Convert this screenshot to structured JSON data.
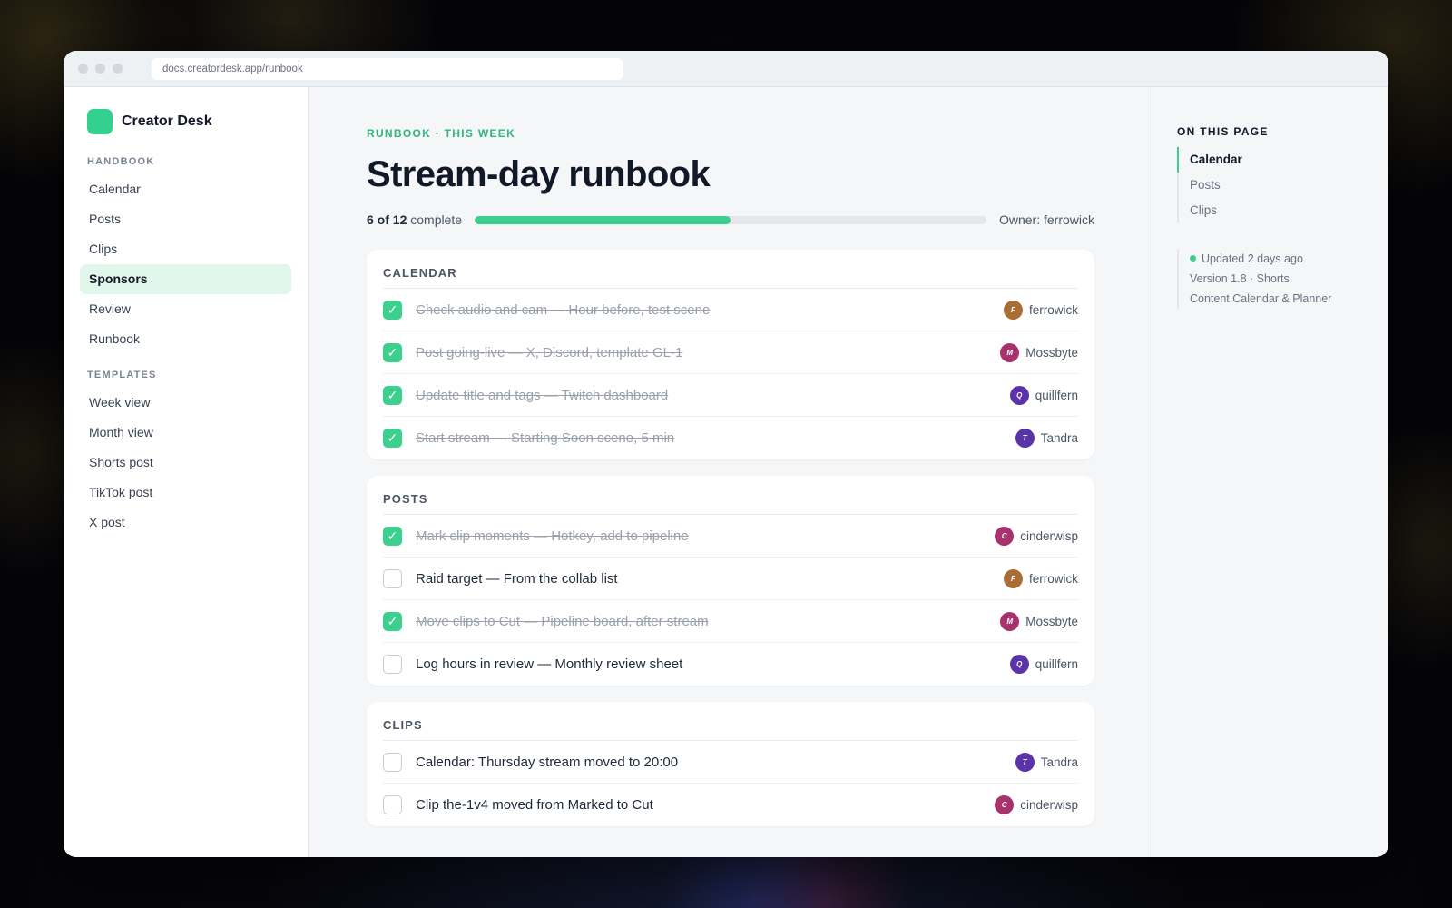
{
  "browser": {
    "url": "docs.creatordesk.app/runbook"
  },
  "sidebar": {
    "brand": "Creator Desk",
    "sections": [
      {
        "heading": "HANDBOOK",
        "items": [
          "Calendar",
          "Posts",
          "Clips",
          "Sponsors",
          "Review",
          "Runbook"
        ]
      },
      {
        "heading": "TEMPLATES",
        "items": [
          "Week view",
          "Month view",
          "Shorts post",
          "TikTok post",
          "X post"
        ]
      }
    ],
    "active_item": "Sponsors"
  },
  "page": {
    "eyebrow": "RUNBOOK · THIS WEEK",
    "title": "Stream-day runbook",
    "progress": {
      "done_label": "6 of 12",
      "suffix": "complete",
      "fraction": 0.5
    },
    "owner": "Owner: ferrowick"
  },
  "people": {
    "ferrowick": {
      "initial": "F",
      "color": "#a86e35"
    },
    "Mossbyte": {
      "initial": "M",
      "color": "#a8326c"
    },
    "quillfern": {
      "initial": "Q",
      "color": "#5b33a8"
    },
    "Tandra": {
      "initial": "T",
      "color": "#5b33a8"
    },
    "cinderwisp": {
      "initial": "C",
      "color": "#a8326c"
    }
  },
  "sections": [
    {
      "title": "CALENDAR",
      "tasks": [
        {
          "text": "Check audio and cam — Hour before, test scene",
          "done": true,
          "assignee": "ferrowick"
        },
        {
          "text": "Post going-live — X, Discord, template GL-1",
          "done": true,
          "assignee": "Mossbyte"
        },
        {
          "text": "Update title and tags — Twitch dashboard",
          "done": true,
          "assignee": "quillfern"
        },
        {
          "text": "Start stream — Starting Soon scene, 5 min",
          "done": true,
          "assignee": "Tandra"
        }
      ]
    },
    {
      "title": "POSTS",
      "tasks": [
        {
          "text": "Mark clip moments — Hotkey, add to pipeline",
          "done": true,
          "assignee": "cinderwisp"
        },
        {
          "text": "Raid target — From the collab list",
          "done": false,
          "assignee": "ferrowick"
        },
        {
          "text": "Move clips to Cut — Pipeline board, after stream",
          "done": true,
          "assignee": "Mossbyte"
        },
        {
          "text": "Log hours in review — Monthly review sheet",
          "done": false,
          "assignee": "quillfern"
        }
      ]
    },
    {
      "title": "CLIPS",
      "tasks": [
        {
          "text": "Calendar: Thursday stream moved to 20:00",
          "done": false,
          "assignee": "Tandra"
        },
        {
          "text": "Clip the-1v4 moved from Marked to Cut",
          "done": false,
          "assignee": "cinderwisp"
        }
      ]
    }
  ],
  "toc": {
    "heading": "ON THIS PAGE",
    "items": [
      "Calendar",
      "Posts",
      "Clips"
    ],
    "active": "Calendar",
    "meta": {
      "updated": "Updated 2 days ago",
      "version": "Version 1.8 · Shorts",
      "collection": "Content Calendar & Planner"
    }
  },
  "colors": {
    "accent": "#3ccf8e",
    "active_nav_bg": "#e1f7ec",
    "eyebrow": "#2fb47c"
  }
}
